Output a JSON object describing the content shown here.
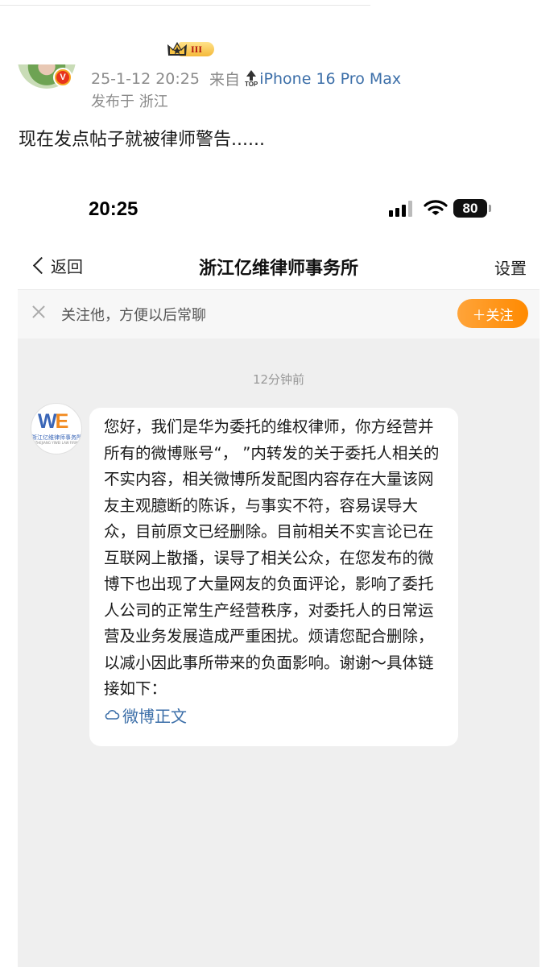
{
  "post": {
    "level_badge": "III",
    "verified_badge": "V",
    "date": "25-1-12 20:25",
    "source_prefix": "来自",
    "top_label": "TOP",
    "device": "iPhone 16 Pro Max",
    "location": "发布于 浙江",
    "text": "现在发点帖子就被律师警告......"
  },
  "screenshot": {
    "status": {
      "time": "20:25",
      "battery": "80"
    },
    "nav": {
      "back_label": "返回",
      "title": "浙江亿维律师事务所",
      "settings_label": "设置"
    },
    "follow_bar": {
      "text": "关注他，方便以后常聊",
      "button_label": "＋关注"
    },
    "chat": {
      "timestamp": "12分钟前",
      "sender_logo": {
        "mark_w": "W",
        "mark_e": "E",
        "name": "浙江亿维律师事务所",
        "sub": "ZHEJIANG YIWEI LAW FIRM"
      },
      "message": "您好，我们是华为委托的维权律师，你方经营并所有的微博账号“，          ”内转发的关于委托人相关的不实内容，相关微博所发配图内容存在大量该网友主观臆断的陈诉，与事实不符，容易误导大众，目前原文已经删除。目前相关不实言论已在互联网上散播，误导了相关公众，在您发布的微博下也出现了大量网友的负面评论，影响了委托人公司的正常生产经营秩序，对委托人的日常运营及业务发展造成严重困扰。烦请您配合删除，以减小因此事所带来的负面影响。谢谢～具体链接如下：",
      "link_label": "微博正文"
    }
  },
  "colors": {
    "accent_orange": "#ff8a00",
    "link_blue": "#3b6ea8",
    "logo_blue": "#3a66b7",
    "chat_bg": "#efefef"
  },
  "icons": [
    "crown-icon",
    "verified-icon",
    "top-arrow-icon",
    "signal-icon",
    "wifi-icon",
    "battery-icon",
    "back-chevron-icon",
    "close-icon",
    "cloud-icon"
  ]
}
